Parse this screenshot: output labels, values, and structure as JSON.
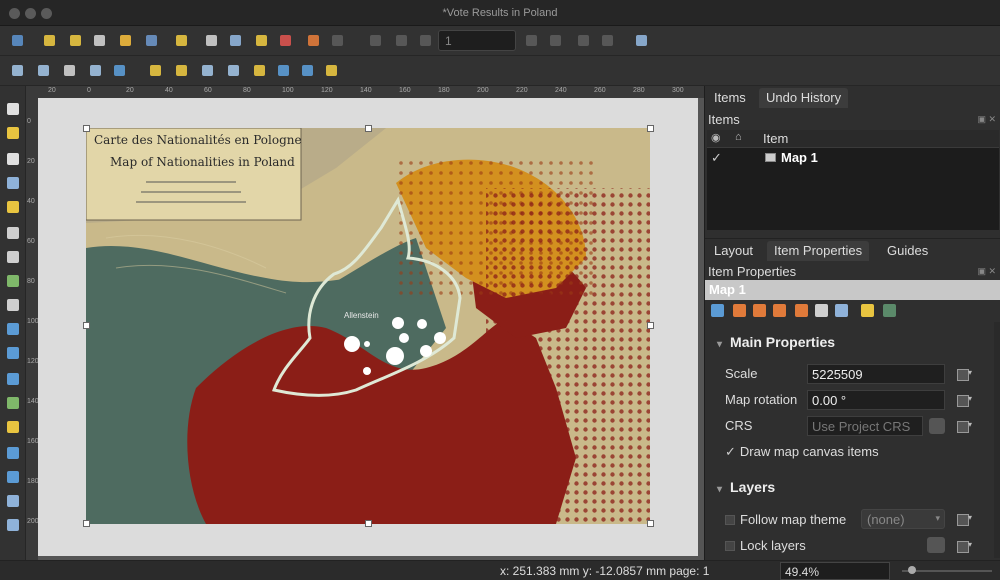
{
  "window": {
    "title": "*Vote Results in Poland"
  },
  "toolbar": {
    "page_value": "1"
  },
  "map": {
    "title_fr": "Carte des Nationalités en Pologne",
    "title_en": "Map of Nationalities in Poland",
    "place_label": "Allenstein"
  },
  "dock": {
    "top_tabs": [
      "Items",
      "Undo History"
    ],
    "items_panel_title": "Items",
    "items_column": "Item",
    "items": [
      {
        "checked": true,
        "name": "Map 1"
      }
    ],
    "bottom_tabs": [
      "Layout",
      "Item Properties",
      "Guides"
    ],
    "item_props_title": "Item Properties",
    "selected_item": "Map 1",
    "main_props_header": "Main Properties",
    "scale_label": "Scale",
    "scale_value": "5225509",
    "rotation_label": "Map rotation",
    "rotation_value": "0.00 °",
    "crs_label": "CRS",
    "crs_value": "Use Project CRS",
    "draw_canvas_items_label": "Draw map canvas items",
    "layers_header": "Layers",
    "follow_theme_label": "Follow map theme",
    "follow_theme_value": "(none)",
    "lock_layers_label": "Lock layers"
  },
  "status": {
    "coords": "x: 251.383 mm  y: -12.0857 mm  page: 1",
    "zoom": "49.4%"
  },
  "ruler": {
    "h_ticks": [
      "20",
      "0",
      "20",
      "40",
      "60",
      "80",
      "100",
      "120",
      "140",
      "160",
      "180",
      "200",
      "220",
      "240",
      "260",
      "280",
      "300"
    ],
    "v_ticks": [
      "0",
      "20",
      "40",
      "60",
      "80",
      "100",
      "120",
      "140",
      "160",
      "180",
      "200"
    ]
  },
  "colors": {
    "ocean_green": "#4e6b60",
    "german_red": "#8b1e17",
    "orange_region": "#d3901f",
    "parchment": "#c9b98a",
    "boundary": "#dfe9d6"
  }
}
